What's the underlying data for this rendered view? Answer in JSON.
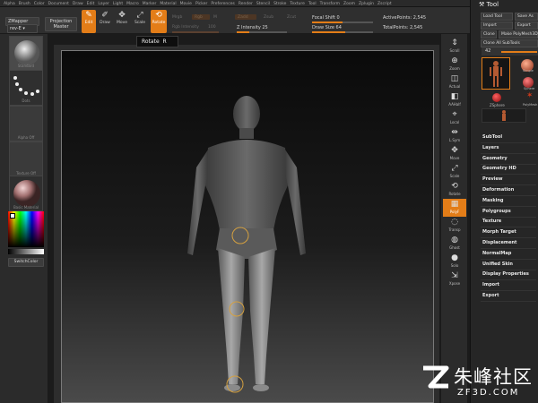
{
  "menu": [
    "Alpha",
    "Brush",
    "Color",
    "Document",
    "Draw",
    "Edit",
    "Layer",
    "Light",
    "Macro",
    "Marker",
    "Material",
    "Movie",
    "Picker",
    "Preferences",
    "Render",
    "Stencil",
    "Stroke",
    "Texture",
    "Tool",
    "Transform",
    "Zoom",
    "Zplugin",
    "Zscript"
  ],
  "toolbar": {
    "zmapper": "ZMapper",
    "rev": "rev-E",
    "projection": "Projection",
    "master": "Master",
    "edit": "Edit",
    "draw": "Draw",
    "move": "Move",
    "scale": "Scale",
    "rotate": "Rotate",
    "mrgb": "Mrgb",
    "rgb": "Rgb",
    "m": "M",
    "zadd": "Zadd",
    "zsub": "Zsub",
    "zcut": "Zcut",
    "rgb_intensity": "Rgb Intensity",
    "z_intensity": "Z Intensity",
    "z_intensity_value": "25",
    "focal_shift": "Focal Shift",
    "focal_shift_value": "0",
    "draw_size": "Draw Size",
    "draw_size_value": "64",
    "active_points": "ActivePoints:",
    "active_points_value": "2,545",
    "total_points": "TotalPoints:",
    "total_points_value": "2,545",
    "rgb_intensity_value": "100",
    "rgb_intensity_fill": 1.0,
    "z_intensity_fill": 0.25,
    "focal_shift_fill": 0.5,
    "draw_size_fill": 0.55
  },
  "tooltip": {
    "label": "Rotate",
    "key": "R"
  },
  "left_shelf": {
    "brush": "Standard",
    "stroke": "Dots",
    "alpha": "Alpha Off",
    "texture": "Texture Off",
    "material": "Basic Material",
    "switch_color": "SwitchColor"
  },
  "right_strip": [
    "Scroll",
    "Zoom",
    "Actual",
    "AAHalf",
    "Local",
    "L.Sym",
    "Move",
    "Scale",
    "Rotate",
    "PolyF",
    "Transp",
    "Ghost",
    "Solo",
    "Xpose"
  ],
  "tool_panel": {
    "title": "Tool",
    "load_tool": "Load Tool",
    "save_as": "Save As",
    "import": "Import",
    "export": "Export",
    "clone": "Clone",
    "make_polymesh": "Make PolyMesh3D",
    "clone_all_subtools": "Clone All SubTools",
    "tool_count": "42",
    "thumb_labels": [
      "Simple",
      "Sphere",
      "ZSphere",
      "PolyMesh"
    ],
    "sections": [
      "SubTool",
      "Layers",
      "Geometry",
      "Geometry HD",
      "Preview",
      "Deformation",
      "Masking",
      "Polygroups",
      "Texture",
      "Morph Target",
      "Displacement",
      "NormalMap",
      "Unified Skin",
      "Display Properties",
      "Import",
      "Export"
    ]
  },
  "watermark": {
    "chinese": "朱峰社区",
    "site": "ZF3D.COM"
  },
  "colors": {
    "accent": "#e37d18",
    "panel": "#262626",
    "canvas_top": "#0a0a0a",
    "canvas_bottom": "#4a4a4a"
  }
}
